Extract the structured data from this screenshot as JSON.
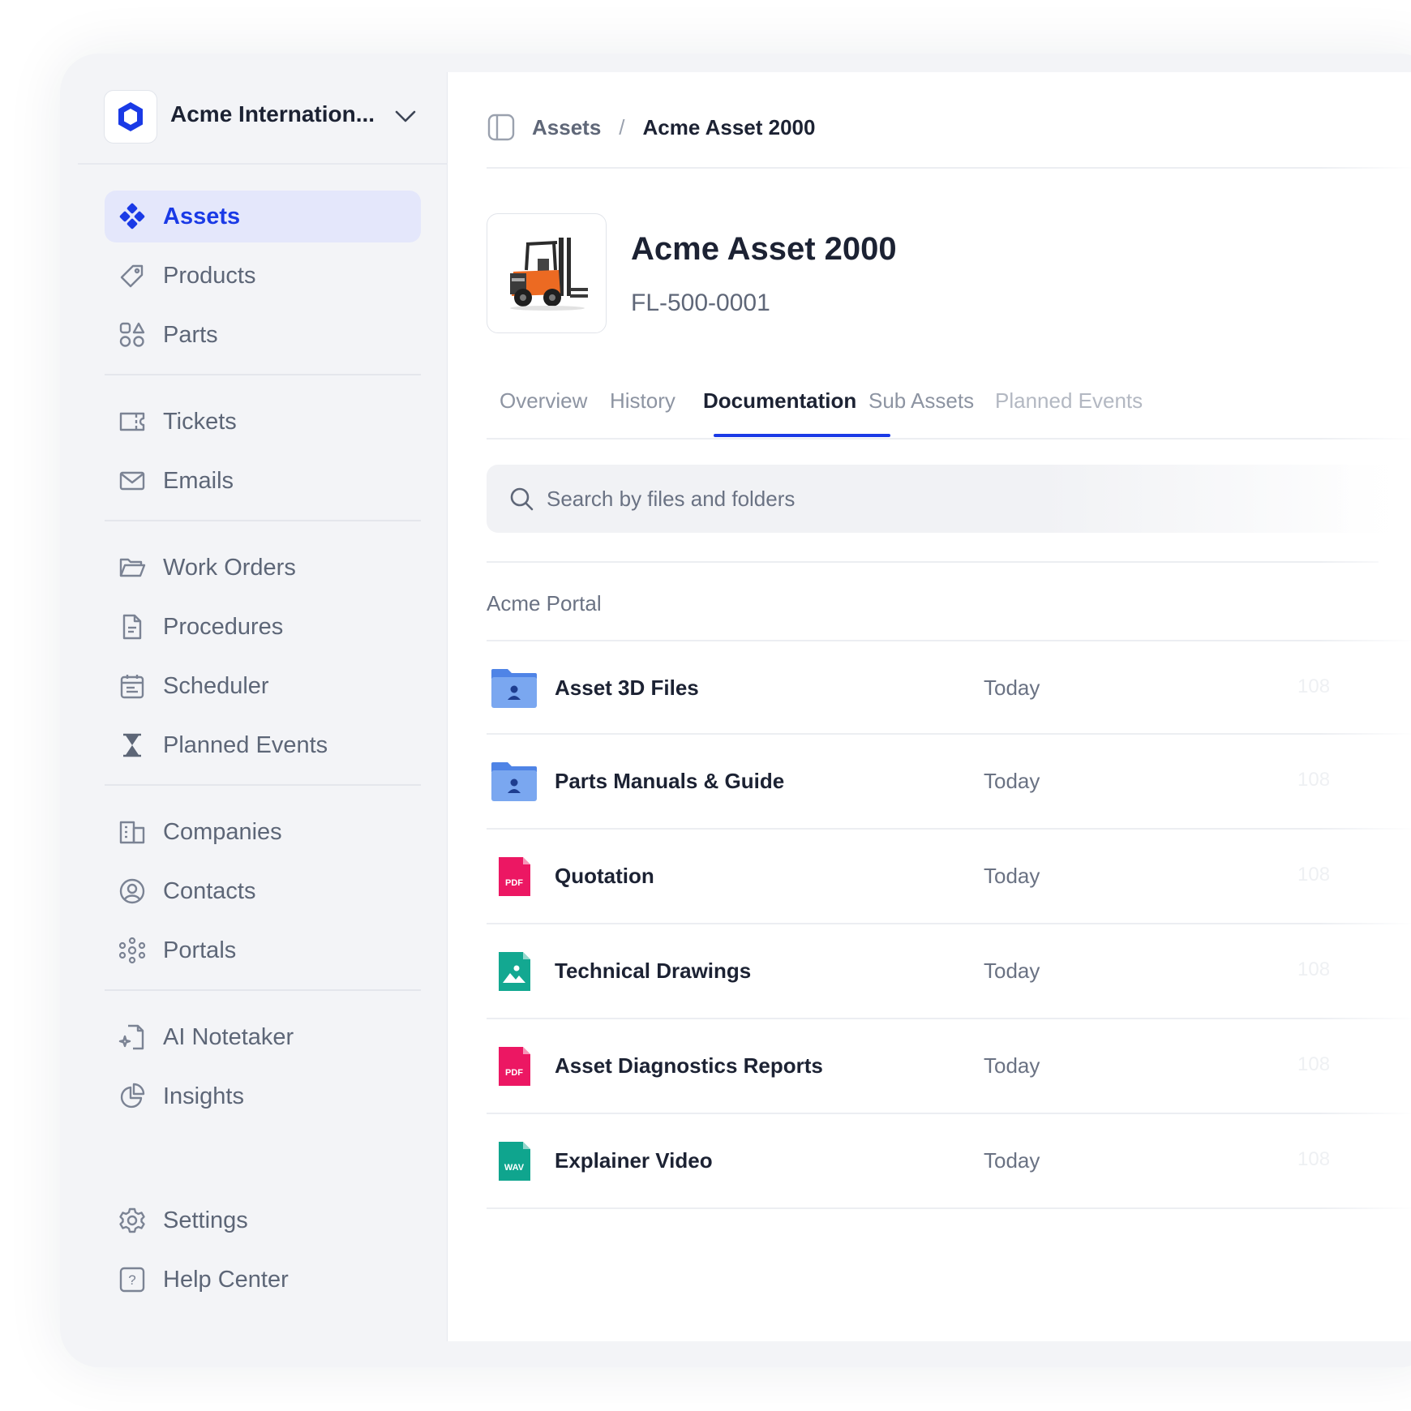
{
  "org": {
    "name": "Acme Internation..."
  },
  "sidebar": {
    "groups": [
      [
        {
          "label": "Assets",
          "icon": "assets-icon",
          "active": true
        },
        {
          "label": "Products",
          "icon": "tag-icon"
        },
        {
          "label": "Parts",
          "icon": "shapes-icon"
        }
      ],
      [
        {
          "label": "Tickets",
          "icon": "ticket-icon"
        },
        {
          "label": "Emails",
          "icon": "mail-icon"
        }
      ],
      [
        {
          "label": "Work Orders",
          "icon": "folder-open-icon"
        },
        {
          "label": "Procedures",
          "icon": "document-icon"
        },
        {
          "label": "Scheduler",
          "icon": "calendar-icon"
        },
        {
          "label": "Planned Events",
          "icon": "hourglass-icon"
        }
      ],
      [
        {
          "label": "Companies",
          "icon": "building-icon"
        },
        {
          "label": "Contacts",
          "icon": "user-circle-icon"
        },
        {
          "label": "Portals",
          "icon": "network-icon"
        }
      ],
      [
        {
          "label": "AI Notetaker",
          "icon": "ai-note-icon"
        },
        {
          "label": "Insights",
          "icon": "pie-chart-icon"
        }
      ]
    ],
    "bottom": [
      {
        "label": "Settings",
        "icon": "gear-icon"
      },
      {
        "label": "Help Center",
        "icon": "help-icon"
      }
    ]
  },
  "breadcrumb": {
    "parent": "Assets",
    "separator": "/",
    "current": "Acme Asset 2000"
  },
  "asset": {
    "title": "Acme Asset 2000",
    "code": "FL-500-0001"
  },
  "tabs": [
    "Overview",
    "History",
    "Documentation",
    "Sub Assets",
    "Planned Events"
  ],
  "active_tab": "Documentation",
  "search": {
    "placeholder": "Search by files and folders",
    "value": ""
  },
  "section": {
    "label": "Acme Portal"
  },
  "files": [
    {
      "name": "Asset 3D Files",
      "date": "Today",
      "size": "108",
      "type": "folder"
    },
    {
      "name": "Parts Manuals & Guide",
      "date": "Today",
      "size": "108",
      "type": "folder"
    },
    {
      "name": "Quotation",
      "date": "Today",
      "size": "108",
      "type": "pdf",
      "badge": "PDF"
    },
    {
      "name": "Technical Drawings",
      "date": "Today",
      "size": "108",
      "type": "image"
    },
    {
      "name": "Asset Diagnostics Reports",
      "date": "Today",
      "size": "108",
      "type": "pdf",
      "badge": "PDF"
    },
    {
      "name": "Explainer Video",
      "date": "Today",
      "size": "108",
      "type": "wav",
      "badge": "WAV"
    }
  ],
  "colors": {
    "accent": "#1a3ae6",
    "folder": "#7aa7f0",
    "pdf": "#ec1763",
    "image": "#13a891",
    "wav": "#0fa58e"
  }
}
